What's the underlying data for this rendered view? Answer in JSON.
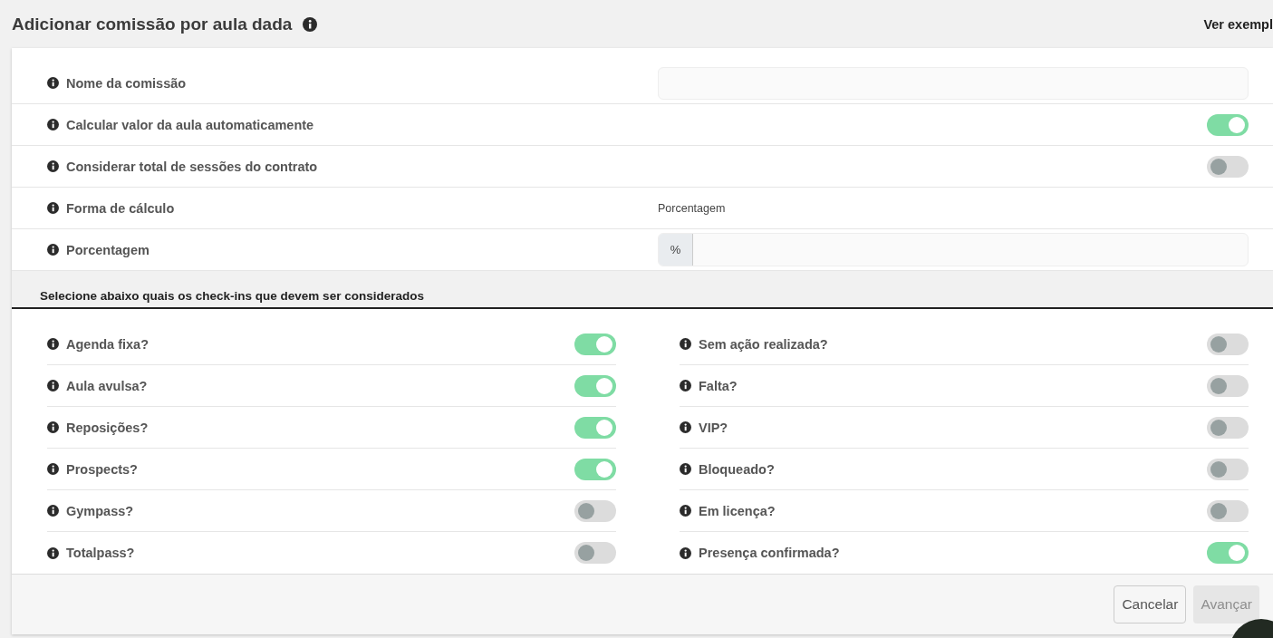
{
  "title": "Adicionar comissão por aula dada",
  "example_link": "Ver exempl",
  "fields": [
    {
      "kind": "text_input",
      "label": "Nome da comissão"
    },
    {
      "kind": "toggle",
      "label": "Calcular valor da aula automaticamente",
      "on": true
    },
    {
      "kind": "toggle",
      "label": "Considerar total de sessões do contrato",
      "on": false
    },
    {
      "kind": "static",
      "label": "Forma de cálculo",
      "value": "Porcentagem"
    },
    {
      "kind": "percent_input",
      "label": "Porcentagem",
      "addon": "%"
    }
  ],
  "checkins": {
    "heading": "Selecione abaixo quais os check-ins que devem ser considerados",
    "left": [
      {
        "label": "Agenda fixa?",
        "on": true
      },
      {
        "label": "Aula avulsa?",
        "on": true
      },
      {
        "label": "Reposições?",
        "on": true
      },
      {
        "label": "Prospects?",
        "on": true
      },
      {
        "label": "Gympass?",
        "on": false
      },
      {
        "label": "Totalpass?",
        "on": false
      }
    ],
    "right": [
      {
        "label": "Sem ação realizada?",
        "on": false
      },
      {
        "label": "Falta?",
        "on": false
      },
      {
        "label": "VIP?",
        "on": false
      },
      {
        "label": "Bloqueado?",
        "on": false
      },
      {
        "label": "Em licença?",
        "on": false
      },
      {
        "label": "Presença confirmada?",
        "on": true
      }
    ]
  },
  "buttons": [
    {
      "label": "Cancelar",
      "disabled": false
    },
    {
      "label": "Avançar",
      "disabled": true
    }
  ]
}
